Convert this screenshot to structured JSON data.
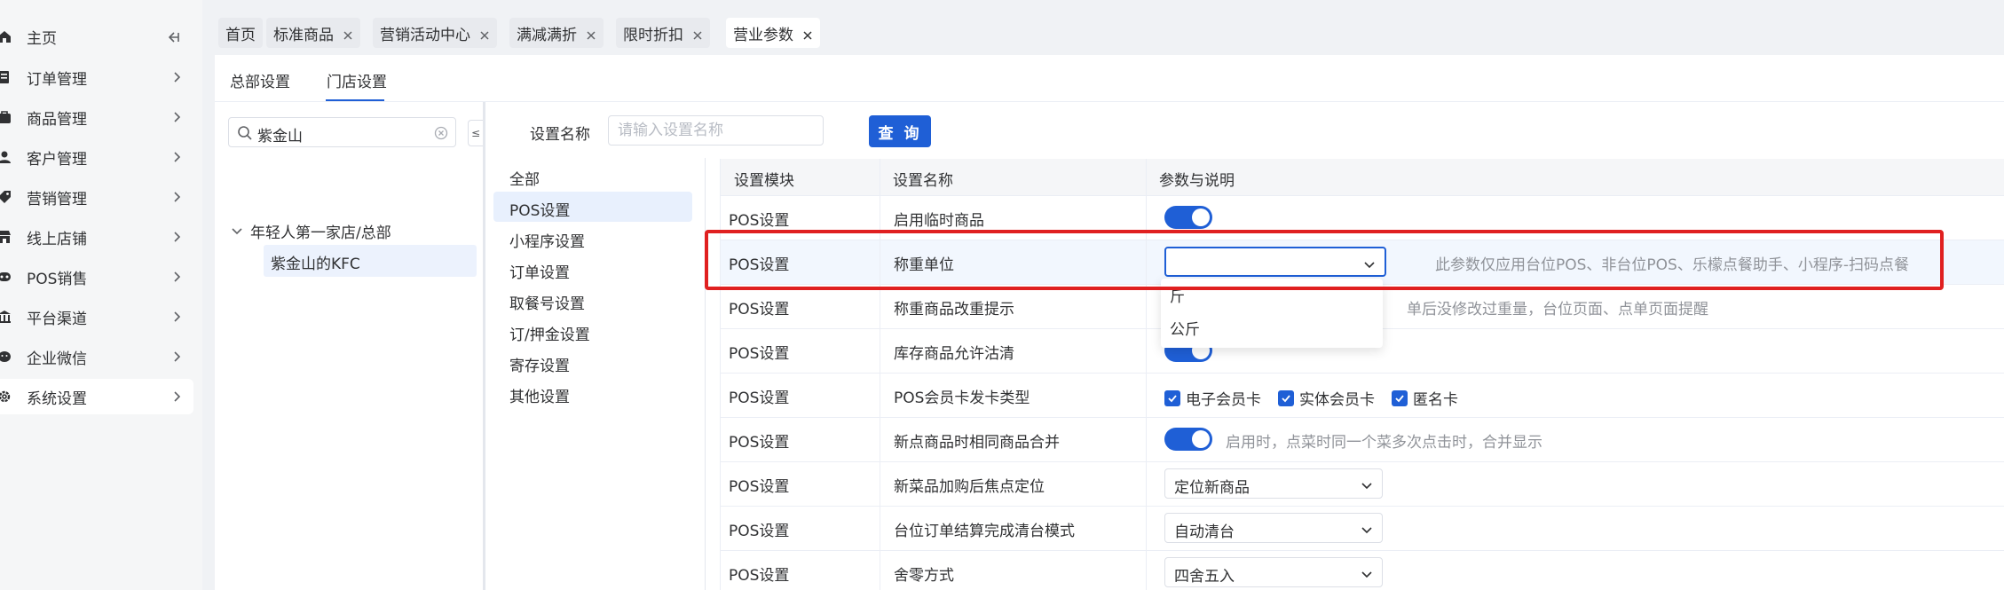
{
  "sidebar": {
    "items": [
      {
        "label": "主页",
        "icon": "home-icon"
      },
      {
        "label": "订单管理",
        "icon": "order-icon"
      },
      {
        "label": "商品管理",
        "icon": "goods-icon"
      },
      {
        "label": "客户管理",
        "icon": "user-icon"
      },
      {
        "label": "营销管理",
        "icon": "tag-icon"
      },
      {
        "label": "线上店铺",
        "icon": "store-icon"
      },
      {
        "label": "POS销售",
        "icon": "pos-icon"
      },
      {
        "label": "平台渠道",
        "icon": "bank-icon"
      },
      {
        "label": "企业微信",
        "icon": "wechat-icon"
      },
      {
        "label": "系统设置",
        "icon": "gear-icon"
      }
    ]
  },
  "tabs": [
    {
      "label": "首页",
      "closable": false
    },
    {
      "label": "标准商品",
      "closable": true
    },
    {
      "label": "营销活动中心",
      "closable": true
    },
    {
      "label": "满减满折",
      "closable": true
    },
    {
      "label": "限时折扣",
      "closable": true
    },
    {
      "label": "营业参数",
      "closable": true,
      "active": true
    }
  ],
  "subtabs": [
    "总部设置",
    "门店设置"
  ],
  "tree": {
    "search_value": "紫金山",
    "toggle_glyph": "≤",
    "root": "年轻人第一家店/总部",
    "child": "紫金山的KFC"
  },
  "categories": [
    "全部",
    "POS设置",
    "小程序设置",
    "订单设置",
    "取餐号设置",
    "订/押金设置",
    "寄存设置",
    "其他设置"
  ],
  "filter": {
    "label": "设置名称",
    "placeholder": "请输入设置名称",
    "button": "查 询"
  },
  "table": {
    "headers": [
      "设置模块",
      "设置名称",
      "参数与说明"
    ],
    "rows": [
      {
        "module": "POS设置",
        "name": "启用临时商品",
        "desc": ""
      },
      {
        "module": "POS设置",
        "name": "称重单位",
        "desc": "此参数仅应用台位POS、非台位POS、乐檬点餐助手、小程序-扫码点餐"
      },
      {
        "module": "POS设置",
        "name": "称重商品改重提示",
        "desc": "单后没修改过重量，台位页面、点单页面提醒"
      },
      {
        "module": "POS设置",
        "name": "库存商品允许沽清",
        "desc": ""
      },
      {
        "module": "POS设置",
        "name": "POS会员卡发卡类型",
        "desc": ""
      },
      {
        "module": "POS设置",
        "name": "新点商品时相同商品合并",
        "desc": "启用时，点菜时同一个菜多次点击时，合并显示"
      },
      {
        "module": "POS设置",
        "name": "新菜品加购后焦点定位",
        "desc": ""
      },
      {
        "module": "POS设置",
        "name": "台位订单结算完成清台模式",
        "desc": ""
      },
      {
        "module": "POS设置",
        "name": "舍零方式",
        "desc": ""
      }
    ],
    "card_types": [
      "电子会员卡",
      "实体会员卡",
      "匿名卡"
    ],
    "selects": {
      "focus_position": "定位新商品",
      "clear_mode": "自动清台",
      "rounding": "四舍五入"
    }
  },
  "dropdown": {
    "options": [
      "斤",
      "公斤"
    ]
  },
  "colors": {
    "accent": "#1f5fd6",
    "highlight_border": "#e02020"
  }
}
